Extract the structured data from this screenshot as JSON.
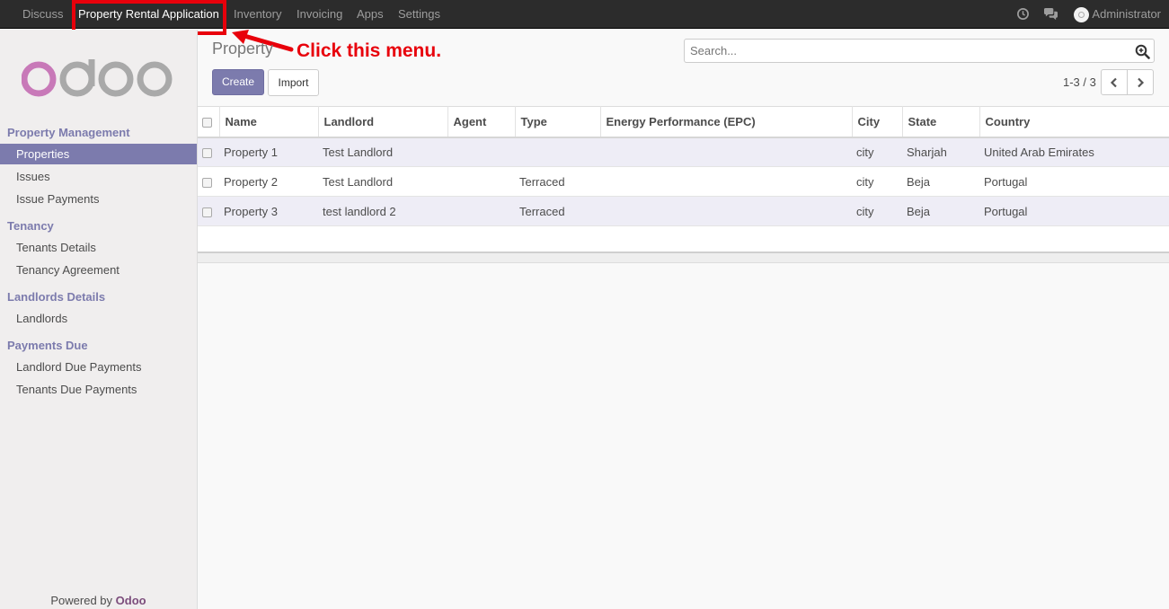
{
  "topbar": {
    "menus": [
      "Discuss",
      "Property Rental Application",
      "Inventory",
      "Invoicing",
      "Apps",
      "Settings"
    ],
    "user": "Administrator",
    "icons": [
      "clock-icon",
      "chat-icon"
    ]
  },
  "annotation": {
    "callout": "Click this menu."
  },
  "sidebar": {
    "logo": "odoo",
    "sections": [
      {
        "title": "Property Management",
        "items": [
          "Properties",
          "Issues",
          "Issue Payments"
        ]
      },
      {
        "title": "Tenancy",
        "items": [
          "Tenants Details",
          "Tenancy Agreement"
        ]
      },
      {
        "title": "Landlords Details",
        "items": [
          "Landlords"
        ]
      },
      {
        "title": "Payments Due",
        "items": [
          "Landlord Due Payments",
          "Tenants Due Payments"
        ]
      }
    ],
    "powered_prefix": "Powered by",
    "powered_brand": "Odoo"
  },
  "control": {
    "breadcrumb": "Property",
    "create_label": "Create",
    "import_label": "Import",
    "search_placeholder": "Search...",
    "pager": "1-3 / 3"
  },
  "table": {
    "columns": [
      "Name",
      "Landlord",
      "Agent",
      "Type",
      "Energy Performance (EPC)",
      "City",
      "State",
      "Country"
    ],
    "rows": [
      {
        "name": "Property 1",
        "landlord": "Test Landlord",
        "agent": "",
        "type": "",
        "epc": "",
        "city": "city",
        "state": "Sharjah",
        "country": "United Arab Emirates"
      },
      {
        "name": "Property 2",
        "landlord": "Test Landlord",
        "agent": "",
        "type": "Terraced",
        "epc": "",
        "city": "city",
        "state": "Beja",
        "country": "Portugal"
      },
      {
        "name": "Property 3",
        "landlord": "test landlord 2",
        "agent": "",
        "type": "Terraced",
        "epc": "",
        "city": "city",
        "state": "Beja",
        "country": "Portugal"
      }
    ]
  },
  "colors": {
    "topbar": "#2c2c2c",
    "accent": "#7c7bad",
    "annotation": "#e8000b",
    "logo_pink": "#c879b8",
    "logo_grey": "#a9a9a9"
  }
}
